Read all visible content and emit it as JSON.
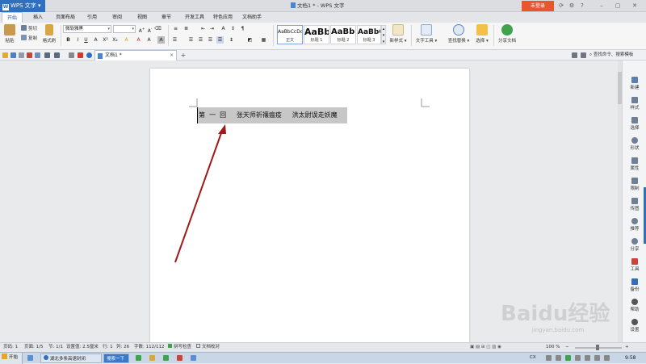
{
  "app": {
    "name": "WPS 文字",
    "doc_title": "文档1 * - WPS 文字",
    "login": "未登录"
  },
  "menu": [
    "开始",
    "插入",
    "页面布局",
    "引用",
    "审阅",
    "视图",
    "章节",
    "开发工具",
    "特色应用",
    "文档助手"
  ],
  "ribbon": {
    "paste": "粘贴",
    "cut": "剪切",
    "copy": "复制",
    "format_painter": "格式刷",
    "font_name": "微软雅黑",
    "font_size": "",
    "styles": [
      {
        "sample": "AaBbCcDd",
        "caption": "正文"
      },
      {
        "sample": "AaBb",
        "caption": "标题 1"
      },
      {
        "sample": "AaBb(",
        "caption": "标题 2"
      },
      {
        "sample": "AaBbC",
        "caption": "标题 3"
      }
    ],
    "new_style": "新样式",
    "text_tools": "文字工具",
    "find_replace": "查找替换",
    "select": "选择",
    "share_doc": "分享文档"
  },
  "tabs": {
    "doc_tab": "文档1 *",
    "search_cmd": "查找命令、搜索模板"
  },
  "document": {
    "heading": "第  一  回     张天师祈禳瘟疫     洪太尉误走妖魔"
  },
  "rail": [
    "新建",
    "样式",
    "选择",
    "形状",
    "属性",
    "限制",
    "传图",
    "推荐",
    "分享",
    "工具",
    "备份",
    "帮助",
    "设置"
  ],
  "status": {
    "page": "页码: 1",
    "pages": "页面: 1/5",
    "section": "节: 1/1",
    "setting": "设置值: 2.5厘米",
    "row": "行: 1",
    "col": "列: 26",
    "wordcount": "字数: 112/112",
    "spell": "拼写检查",
    "proof": "文档校对",
    "zoom": "100 %"
  },
  "taskbar": {
    "start": "开始",
    "task1": "湖北多条高速封闭",
    "task2": "搜索一下",
    "ime": "CX",
    "time": "9:58"
  },
  "watermark": {
    "logo": "Baidu经验",
    "url": "jingyan.baidu.com"
  },
  "colors": {
    "accent": "#2e6fbe",
    "login": "#e8552e",
    "arrow": "#a01818",
    "highlight": "#c7c7c7"
  }
}
